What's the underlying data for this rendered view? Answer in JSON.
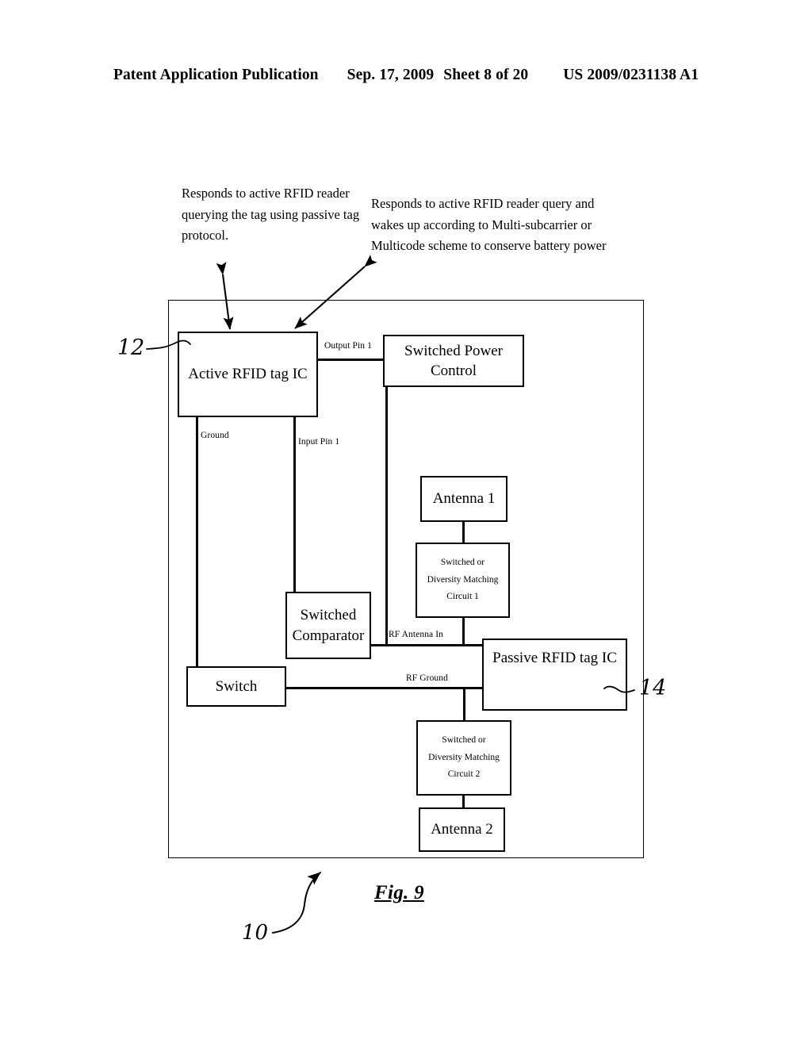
{
  "header": {
    "publication": "Patent Application Publication",
    "date": "Sep. 17, 2009",
    "sheet": "Sheet 8 of 20",
    "patent_number": "US 2009/0231138 A1"
  },
  "figure": {
    "caption": "Fig. 9",
    "callouts": {
      "left": "Responds to active RFID reader querying the tag using passive tag protocol.",
      "right": "Responds to active RFID reader query and wakes up according to Multi-subcarrier or Multicode scheme to conserve battery power"
    },
    "reference_numerals": {
      "system": "10",
      "active_tag": "12",
      "passive_tag": "14"
    },
    "blocks": {
      "active_tag": "Active RFID tag IC",
      "power_control_line1": "Switched Power",
      "power_control_line2": "Control",
      "antenna1": "Antenna 1",
      "match1_line1": "Switched or",
      "match1_line2": "Diversity Matching",
      "match1_line3": "Circuit 1",
      "comparator_line1": "Switched",
      "comparator_line2": "Comparator",
      "passive_tag": "Passive RFID tag IC",
      "switch": "Switch",
      "match2_line1": "Switched or",
      "match2_line2": "Diversity Matching",
      "match2_line3": "Circuit 2",
      "antenna2": "Antenna 2"
    },
    "wire_labels": {
      "output_pin1": "Output Pin 1",
      "ground": "Ground",
      "input_pin1": "Input Pin 1",
      "rf_antenna_in": "RF Antenna In",
      "rf_ground": "RF Ground"
    }
  },
  "colors": {
    "ink": "#000000",
    "paper": "#ffffff"
  }
}
